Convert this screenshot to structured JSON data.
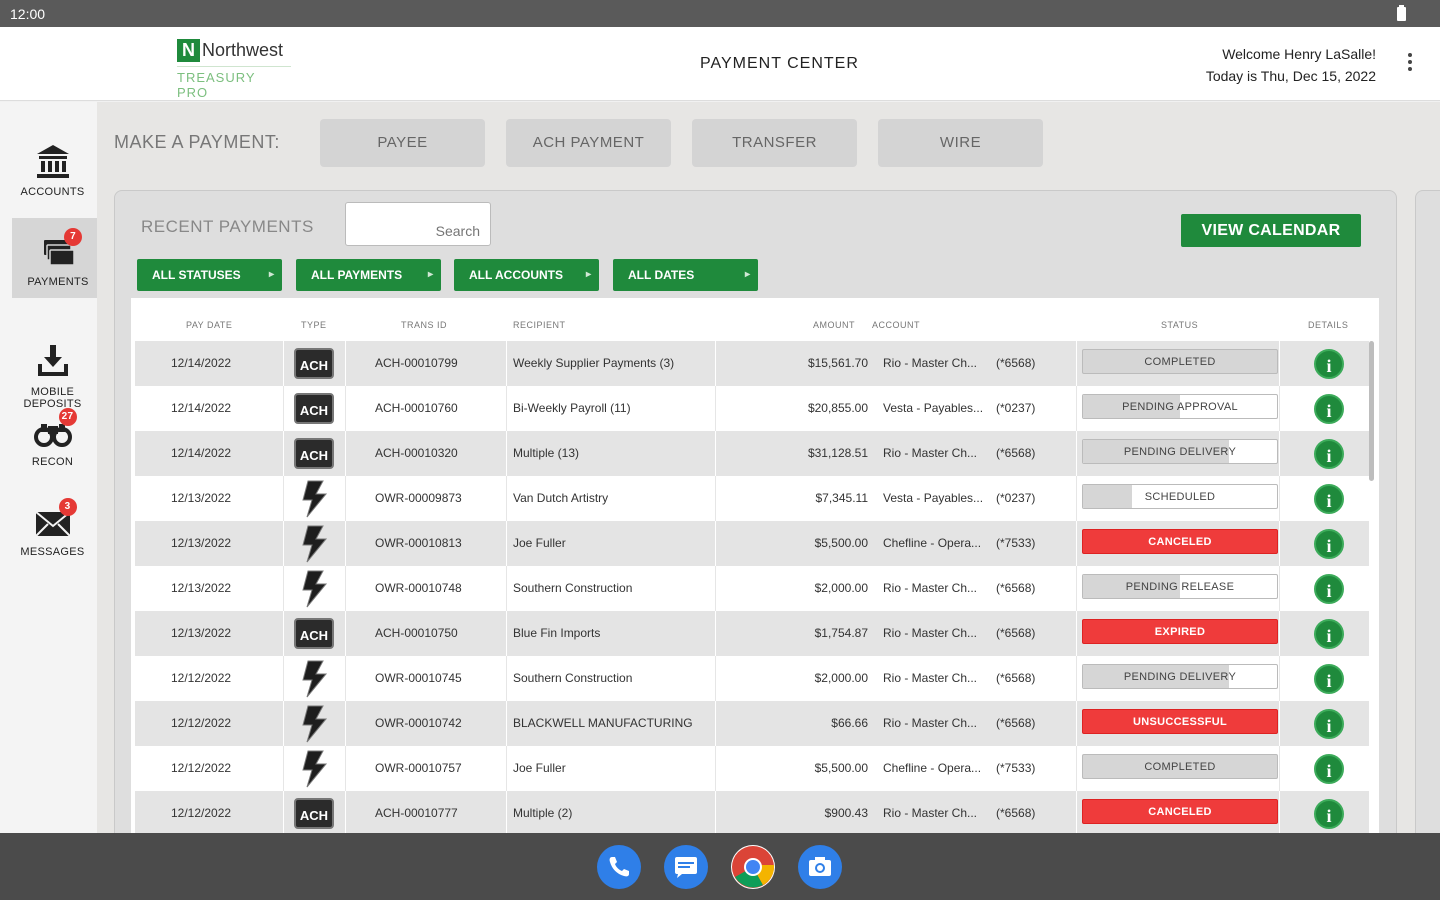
{
  "statusbar": {
    "time": "12:00"
  },
  "header": {
    "logo_badge": "N",
    "logo_name": "Northwest",
    "logo_sub": "TREASURY PRO",
    "title": "PAYMENT CENTER",
    "welcome": "Welcome Henry LaSalle!",
    "today": "Today is Thu, Dec 15, 2022"
  },
  "sidebar": {
    "items": [
      {
        "label": "ACCOUNTS",
        "icon": "bank-icon"
      },
      {
        "label": "PAYMENTS",
        "icon": "payments-icon",
        "badge": "7"
      },
      {
        "label": "MOBILE\nDEPOSITS",
        "icon": "mobile-deposit-icon"
      },
      {
        "label": "RECON",
        "icon": "binoculars-icon",
        "badge": "27"
      },
      {
        "label": "MESSAGES",
        "icon": "envelope-icon",
        "badge": "3"
      }
    ]
  },
  "make_payment": {
    "label": "MAKE A PAYMENT:",
    "buttons": [
      "PAYEE",
      "ACH PAYMENT",
      "TRANSFER",
      "WIRE"
    ]
  },
  "recent": {
    "title": "RECENT PAYMENTS",
    "search_placeholder": "Search",
    "view_calendar": "VIEW CALENDAR",
    "filters": [
      "ALL STATUSES",
      "ALL PAYMENTS",
      "ALL ACCOUNTS",
      "ALL DATES"
    ]
  },
  "table": {
    "headers": {
      "pay_date": "PAY DATE",
      "type": "TYPE",
      "trans_id": "TRANS ID",
      "recipient": "RECIPIENT",
      "amount": "AMOUNT",
      "account": "ACCOUNT",
      "status": "STATUS",
      "details": "DETAILS"
    },
    "rows": [
      {
        "date": "12/14/2022",
        "type": "ACH",
        "id": "ACH-00010799",
        "recipient": "Weekly Supplier Payments (3)",
        "amount": "$15,561.70",
        "account": "Rio - Master Ch...",
        "acct_no": "(*6568)",
        "status": "COMPLETED",
        "status_kind": "completed",
        "progress": 1
      },
      {
        "date": "12/14/2022",
        "type": "ACH",
        "id": "ACH-00010760",
        "recipient": "Bi-Weekly Payroll (11)",
        "amount": "$20,855.00",
        "account": "Vesta - Payables...",
        "acct_no": "(*0237)",
        "status": "PENDING APPROVAL",
        "status_kind": "pending",
        "progress": 0.5
      },
      {
        "date": "12/14/2022",
        "type": "ACH",
        "id": "ACH-00010320",
        "recipient": "Multiple (13)",
        "amount": "$31,128.51",
        "account": "Rio - Master Ch...",
        "acct_no": "(*6568)",
        "status": "PENDING DELIVERY",
        "status_kind": "pending",
        "progress": 0.75
      },
      {
        "date": "12/13/2022",
        "type": "WIRE",
        "id": "OWR-00009873",
        "recipient": "Van Dutch Artistry",
        "amount": "$7,345.11",
        "account": "Vesta - Payables...",
        "acct_no": "(*0237)",
        "status": "SCHEDULED",
        "status_kind": "pending",
        "progress": 0.25
      },
      {
        "date": "12/13/2022",
        "type": "WIRE",
        "id": "OWR-00010813",
        "recipient": "Joe Fuller",
        "amount": "$5,500.00",
        "account": "Chefline - Opera...",
        "acct_no": "(*7533)",
        "status": "CANCELED",
        "status_kind": "red",
        "progress": 1
      },
      {
        "date": "12/13/2022",
        "type": "WIRE",
        "id": "OWR-00010748",
        "recipient": "Southern Construction",
        "amount": "$2,000.00",
        "account": "Rio - Master Ch...",
        "acct_no": "(*6568)",
        "status": "PENDING RELEASE",
        "status_kind": "pending",
        "progress": 0.5
      },
      {
        "date": "12/13/2022",
        "type": "ACH",
        "id": "ACH-00010750",
        "recipient": "Blue Fin Imports",
        "amount": "$1,754.87",
        "account": "Rio - Master Ch...",
        "acct_no": "(*6568)",
        "status": "EXPIRED",
        "status_kind": "red",
        "progress": 1
      },
      {
        "date": "12/12/2022",
        "type": "WIRE",
        "id": "OWR-00010745",
        "recipient": "Southern Construction",
        "amount": "$2,000.00",
        "account": "Rio - Master Ch...",
        "acct_no": "(*6568)",
        "status": "PENDING DELIVERY",
        "status_kind": "pending",
        "progress": 0.75
      },
      {
        "date": "12/12/2022",
        "type": "WIRE",
        "id": "OWR-00010742",
        "recipient": "BLACKWELL MANUFACTURING",
        "amount": "$66.66",
        "account": "Rio - Master Ch...",
        "acct_no": "(*6568)",
        "status": "UNSUCCESSFUL",
        "status_kind": "red",
        "progress": 1
      },
      {
        "date": "12/12/2022",
        "type": "WIRE",
        "id": "OWR-00010757",
        "recipient": "Joe Fuller",
        "amount": "$5,500.00",
        "account": "Chefline - Opera...",
        "acct_no": "(*7533)",
        "status": "COMPLETED",
        "status_kind": "completed",
        "progress": 1
      },
      {
        "date": "12/12/2022",
        "type": "ACH",
        "id": "ACH-00010777",
        "recipient": "Multiple (2)",
        "amount": "$900.43",
        "account": "Rio - Master Ch...",
        "acct_no": "(*6568)",
        "status": "CANCELED",
        "status_kind": "red",
        "progress": 1
      }
    ]
  },
  "colors": {
    "brand_green": "#1f8a3c",
    "status_red": "#ef3b3b",
    "dock": "#4b4b4b"
  },
  "dock": {
    "apps": [
      "phone-icon",
      "messages-icon",
      "chrome-icon",
      "camera-icon"
    ]
  }
}
